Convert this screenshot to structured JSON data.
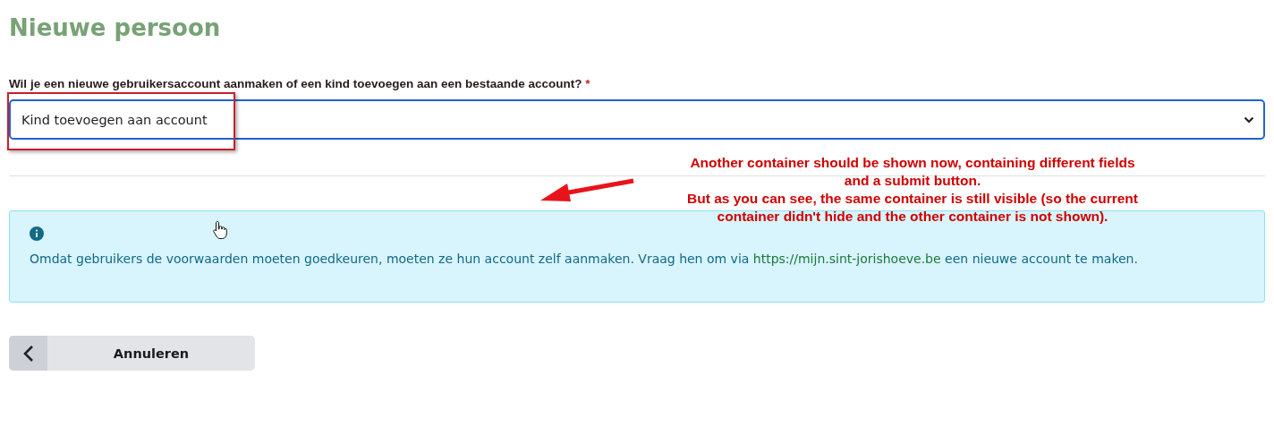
{
  "title": "Nieuwe persoon",
  "question": {
    "label": "Wil je een nieuwe gebruikersaccount aanmaken of een kind toevoegen aan een bestaande account?",
    "required_mark": "*",
    "value": "Kind toevoegen aan account"
  },
  "info": {
    "text_before": "Omdat gebruikers de voorwaarden moeten goedkeuren, moeten ze hun account zelf aanmaken. Vraag hen om via ",
    "link": "https://mijn.sint-jorishoeve.be",
    "text_after": " een nieuwe account te maken."
  },
  "cancel_button": {
    "label": "Annuleren"
  },
  "annotation": {
    "lines": [
      "Another container should be shown now, containing different fields",
      "and a submit button.",
      "But as you can see, the same container is still visible (so the current",
      "container didn't hide and the other container is not shown)."
    ]
  }
}
